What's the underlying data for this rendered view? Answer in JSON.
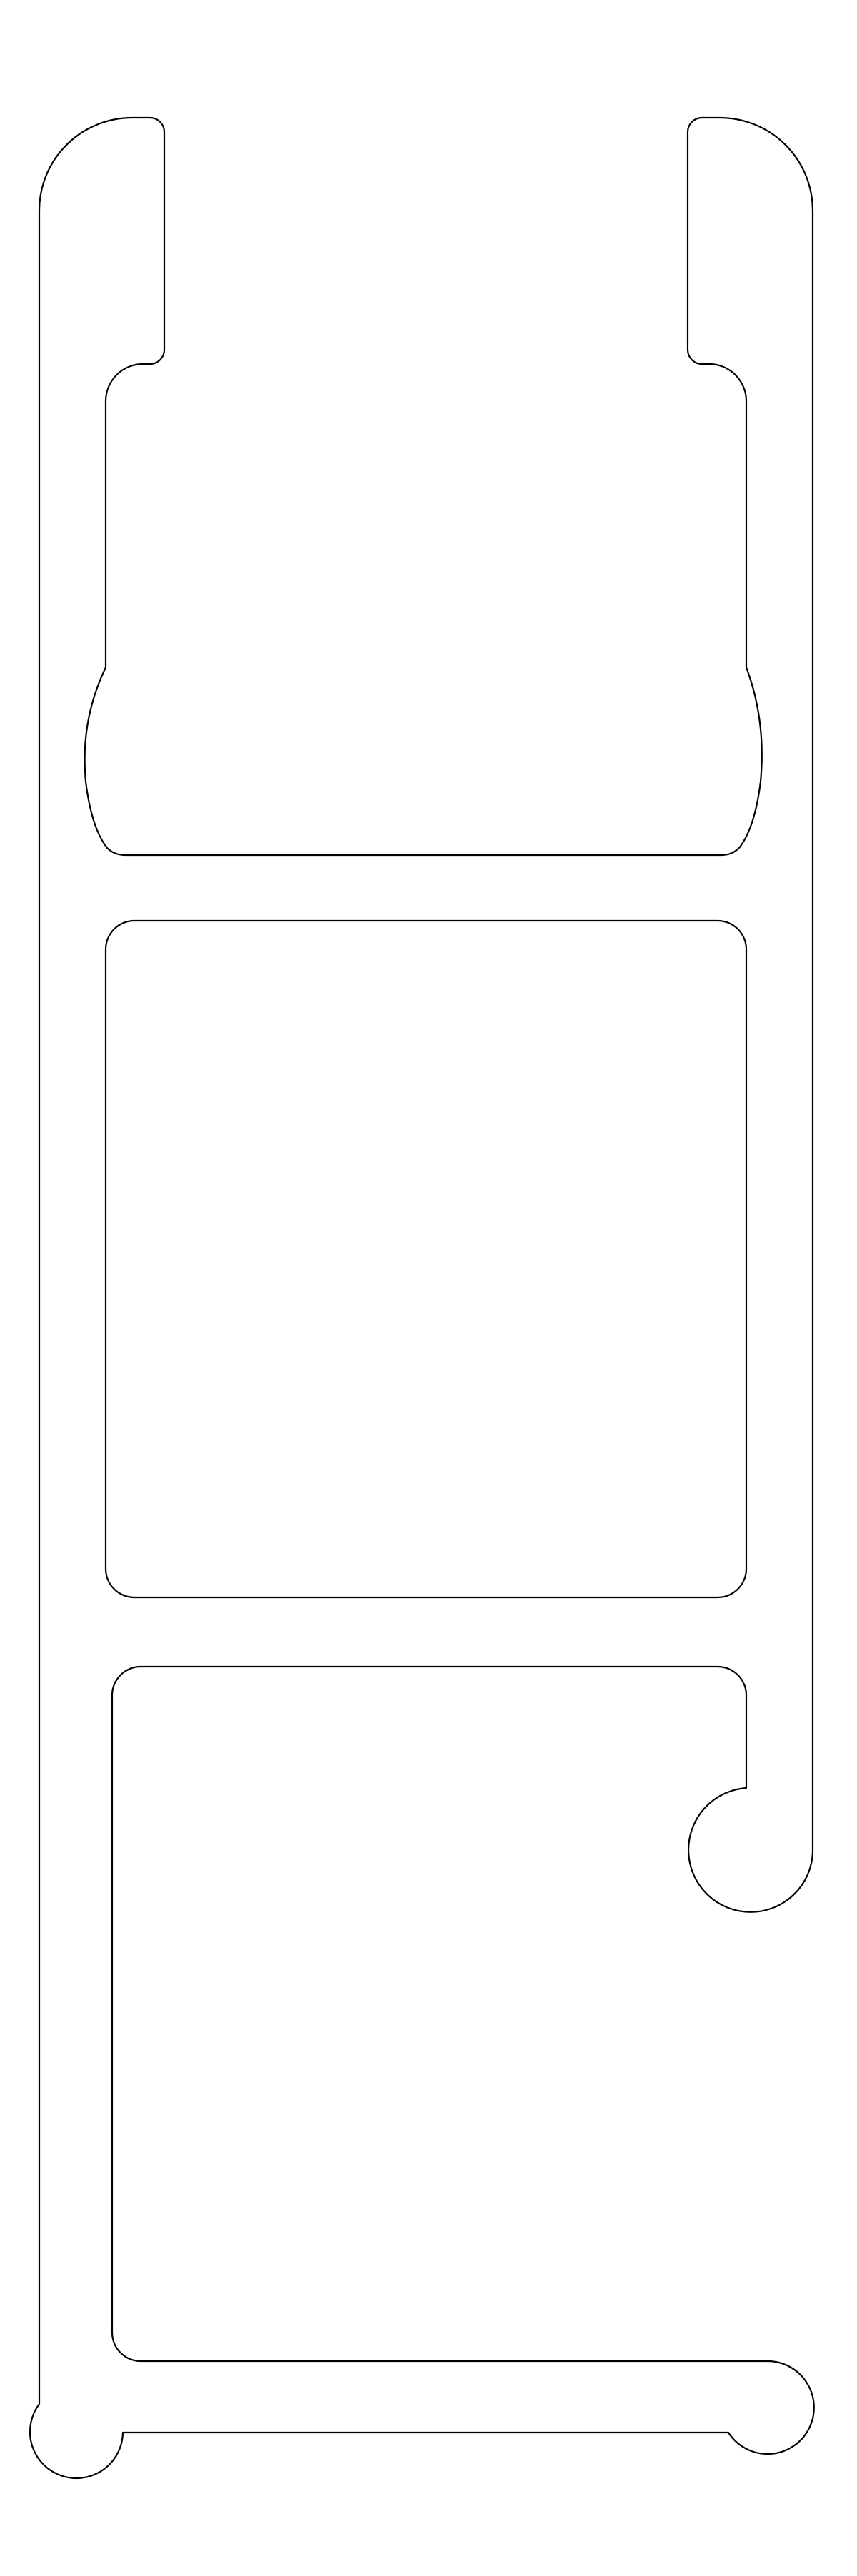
{
  "drawing": {
    "title": "",
    "stroke_color": "#000000",
    "background_color": "#ffffff",
    "parts": [
      "outer-profile-outline",
      "upper-channel-cavity",
      "middle-cavity",
      "lower-cavity"
    ]
  }
}
